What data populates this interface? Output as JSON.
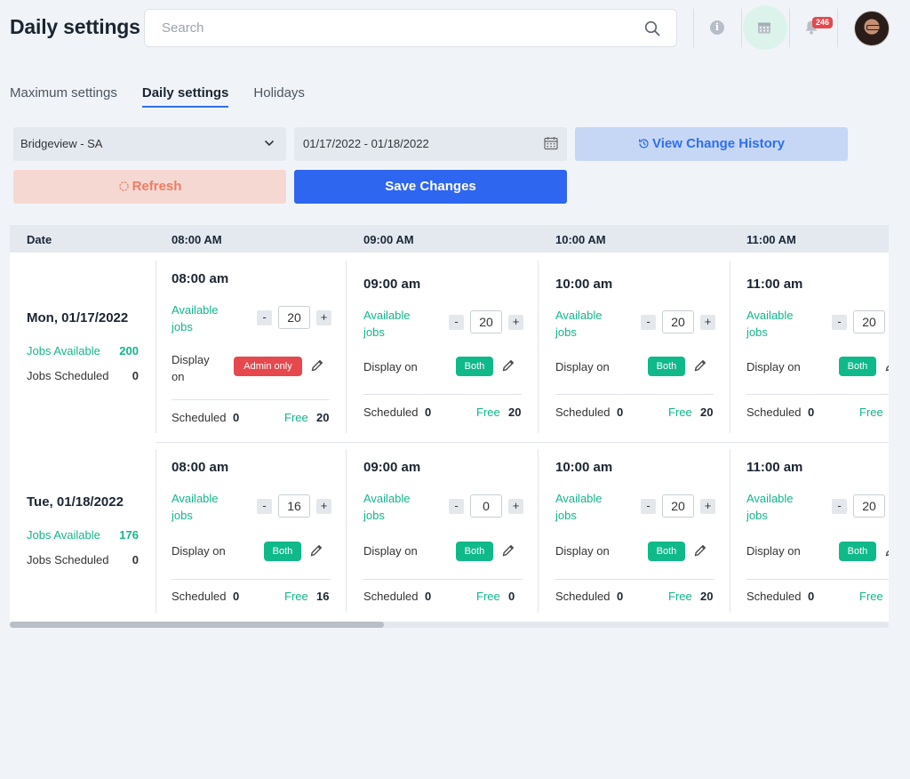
{
  "header": {
    "title": "Daily settings",
    "search_placeholder": "Search",
    "notification_count": "246",
    "icons": [
      "search-icon",
      "info-icon",
      "calendar-icon",
      "bell-icon",
      "avatar"
    ]
  },
  "tabs": [
    {
      "label": "Maximum settings",
      "active": false
    },
    {
      "label": "Daily settings",
      "active": true
    },
    {
      "label": "Holidays",
      "active": false
    }
  ],
  "controls": {
    "location": "Bridgeview - SA",
    "date_range": "01/17/2022 - 01/18/2022",
    "view_history": "View Change History",
    "refresh": "Refresh",
    "save": "Save Changes"
  },
  "table": {
    "headers": [
      "Date",
      "08:00 AM",
      "09:00 AM",
      "10:00 AM",
      "11:00 AM"
    ],
    "labels": {
      "jobs_available": "Jobs Available",
      "jobs_scheduled": "Jobs Scheduled",
      "available_jobs": "Available jobs",
      "display_on": "Display on",
      "scheduled": "Scheduled",
      "free": "Free",
      "minus": "-",
      "plus": "+"
    },
    "rows": [
      {
        "date": "Mon, 01/17/2022",
        "jobs_available": "200",
        "jobs_scheduled": "0",
        "slots": [
          {
            "time": "08:00 am",
            "available": "20",
            "display": "Admin only",
            "scheduled": "0",
            "free": "20"
          },
          {
            "time": "09:00 am",
            "available": "20",
            "display": "Both",
            "scheduled": "0",
            "free": "20"
          },
          {
            "time": "10:00 am",
            "available": "20",
            "display": "Both",
            "scheduled": "0",
            "free": "20"
          },
          {
            "time": "11:00 am",
            "available": "20",
            "display": "Both",
            "scheduled": "0",
            "free": ""
          }
        ]
      },
      {
        "date": "Tue, 01/18/2022",
        "jobs_available": "176",
        "jobs_scheduled": "0",
        "slots": [
          {
            "time": "08:00 am",
            "available": "16",
            "display": "Both",
            "scheduled": "0",
            "free": "16"
          },
          {
            "time": "09:00 am",
            "available": "0",
            "display": "Both",
            "scheduled": "0",
            "free": "0"
          },
          {
            "time": "10:00 am",
            "available": "20",
            "display": "Both",
            "scheduled": "0",
            "free": "20"
          },
          {
            "time": "11:00 am",
            "available": "20",
            "display": "Both",
            "scheduled": "0",
            "free": ""
          }
        ]
      }
    ]
  },
  "colors": {
    "accent": "#2f66f0",
    "green": "#11b68a",
    "admin_pill": "#e5484d",
    "refresh_text": "#ec7e63"
  }
}
